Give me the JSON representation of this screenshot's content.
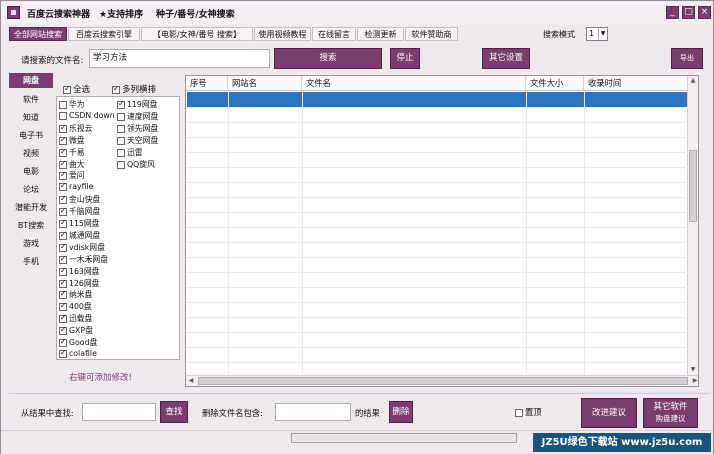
{
  "window": {
    "title_parts": [
      "百度云搜索神器",
      "★支持排序",
      "种子/番号/女神搜索"
    ],
    "controls": [
      "_",
      "□",
      "×"
    ]
  },
  "tabs": [
    "全部网站搜索",
    "百度云搜索引擎",
    "【电影/女神/番号 搜索】",
    "使用视频教程",
    "在线留言",
    "检测更新",
    "软件赞助商"
  ],
  "search_mode": {
    "label": "搜索模式",
    "value": "1"
  },
  "search": {
    "label": "请搜索的文件名:",
    "value": "学习方法",
    "search_button": "搜索",
    "stop_button": "停止",
    "other_settings_button": "其它设置",
    "export_button": "导出excel"
  },
  "categories": [
    "网盘",
    "软件",
    "知道",
    "电子书",
    "视频",
    "电影",
    "论坛",
    "潜能开发",
    "BT搜索",
    "游戏",
    "手机"
  ],
  "site_filter": {
    "check_all": "全选",
    "multi_column": "多列横排",
    "hint": "右键可添加修改!",
    "left_col": [
      {
        "name": "华为",
        "checked": false
      },
      {
        "name": "CSDN down",
        "checked": false
      },
      {
        "name": "乐视云",
        "checked": true
      },
      {
        "name": "微盘",
        "checked": true
      },
      {
        "name": "千易",
        "checked": true
      },
      {
        "name": "曲大",
        "checked": true
      },
      {
        "name": "爱问",
        "checked": true
      },
      {
        "name": "rayfile",
        "checked": true
      },
      {
        "name": "金山快盘",
        "checked": true
      },
      {
        "name": "千脑网盘",
        "checked": true
      },
      {
        "name": "115网盘",
        "checked": true
      },
      {
        "name": "城通网盘",
        "checked": true
      },
      {
        "name": "vdisk网盘",
        "checked": true
      },
      {
        "name": "一木禾网盘",
        "checked": true
      },
      {
        "name": "163网盘",
        "checked": true
      },
      {
        "name": "126网盘",
        "checked": true
      },
      {
        "name": "纳米盘",
        "checked": true
      },
      {
        "name": "400盘",
        "checked": true
      },
      {
        "name": "迅载盘",
        "checked": true
      },
      {
        "name": "GXP盘",
        "checked": true
      },
      {
        "name": "Good盘",
        "checked": true
      },
      {
        "name": "colafile",
        "checked": true
      }
    ],
    "right_col": [
      {
        "name": "119网盘",
        "checked": true
      },
      {
        "name": "速度网盘",
        "checked": false
      },
      {
        "name": "领先网盘",
        "checked": false
      },
      {
        "name": "天空网盘",
        "checked": false
      },
      {
        "name": "迅雷",
        "checked": false
      },
      {
        "name": "QQ旋风",
        "checked": false
      }
    ]
  },
  "results": {
    "columns": [
      "序号",
      "网站名",
      "文件名",
      "文件大小",
      "收录时间"
    ]
  },
  "bottom": {
    "find_label": "从结果中查找:",
    "find_button": "查找",
    "delete_label": "删除文件名包含:",
    "delete_suffix": "的结果",
    "delete_button": "删除",
    "top_checkbox": "置顶",
    "improve_button": "改进建议",
    "other_software_button": "其它软件",
    "other_software_sub": "购盘建议"
  },
  "progress": 0.0,
  "watermark": "JZ5U绿色下载站 www.jz5u.com",
  "colors": {
    "accent": "#7a3d6e",
    "selection": "#2b74c0",
    "watermark_bg": "#17557d"
  }
}
